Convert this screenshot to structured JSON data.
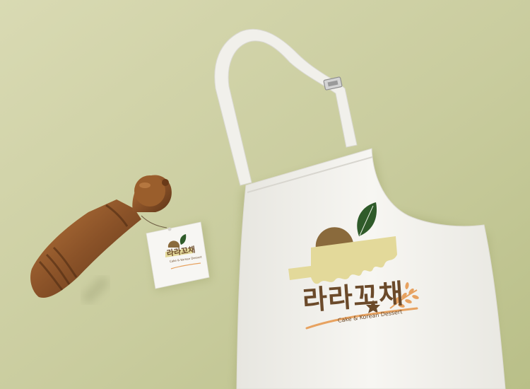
{
  "brand": {
    "name_ko": "라라꼬채",
    "tagline": "Cake & Korean Dessert"
  },
  "colors": {
    "background": "#c9cc9e",
    "apron": "#f4f3ef",
    "logo_brown": "#6b4a2a",
    "logo_yellow": "#e3d99a",
    "logo_leaf": "#2f5b2a",
    "logo_orange": "#e7a260",
    "wood": "#8a5228"
  }
}
